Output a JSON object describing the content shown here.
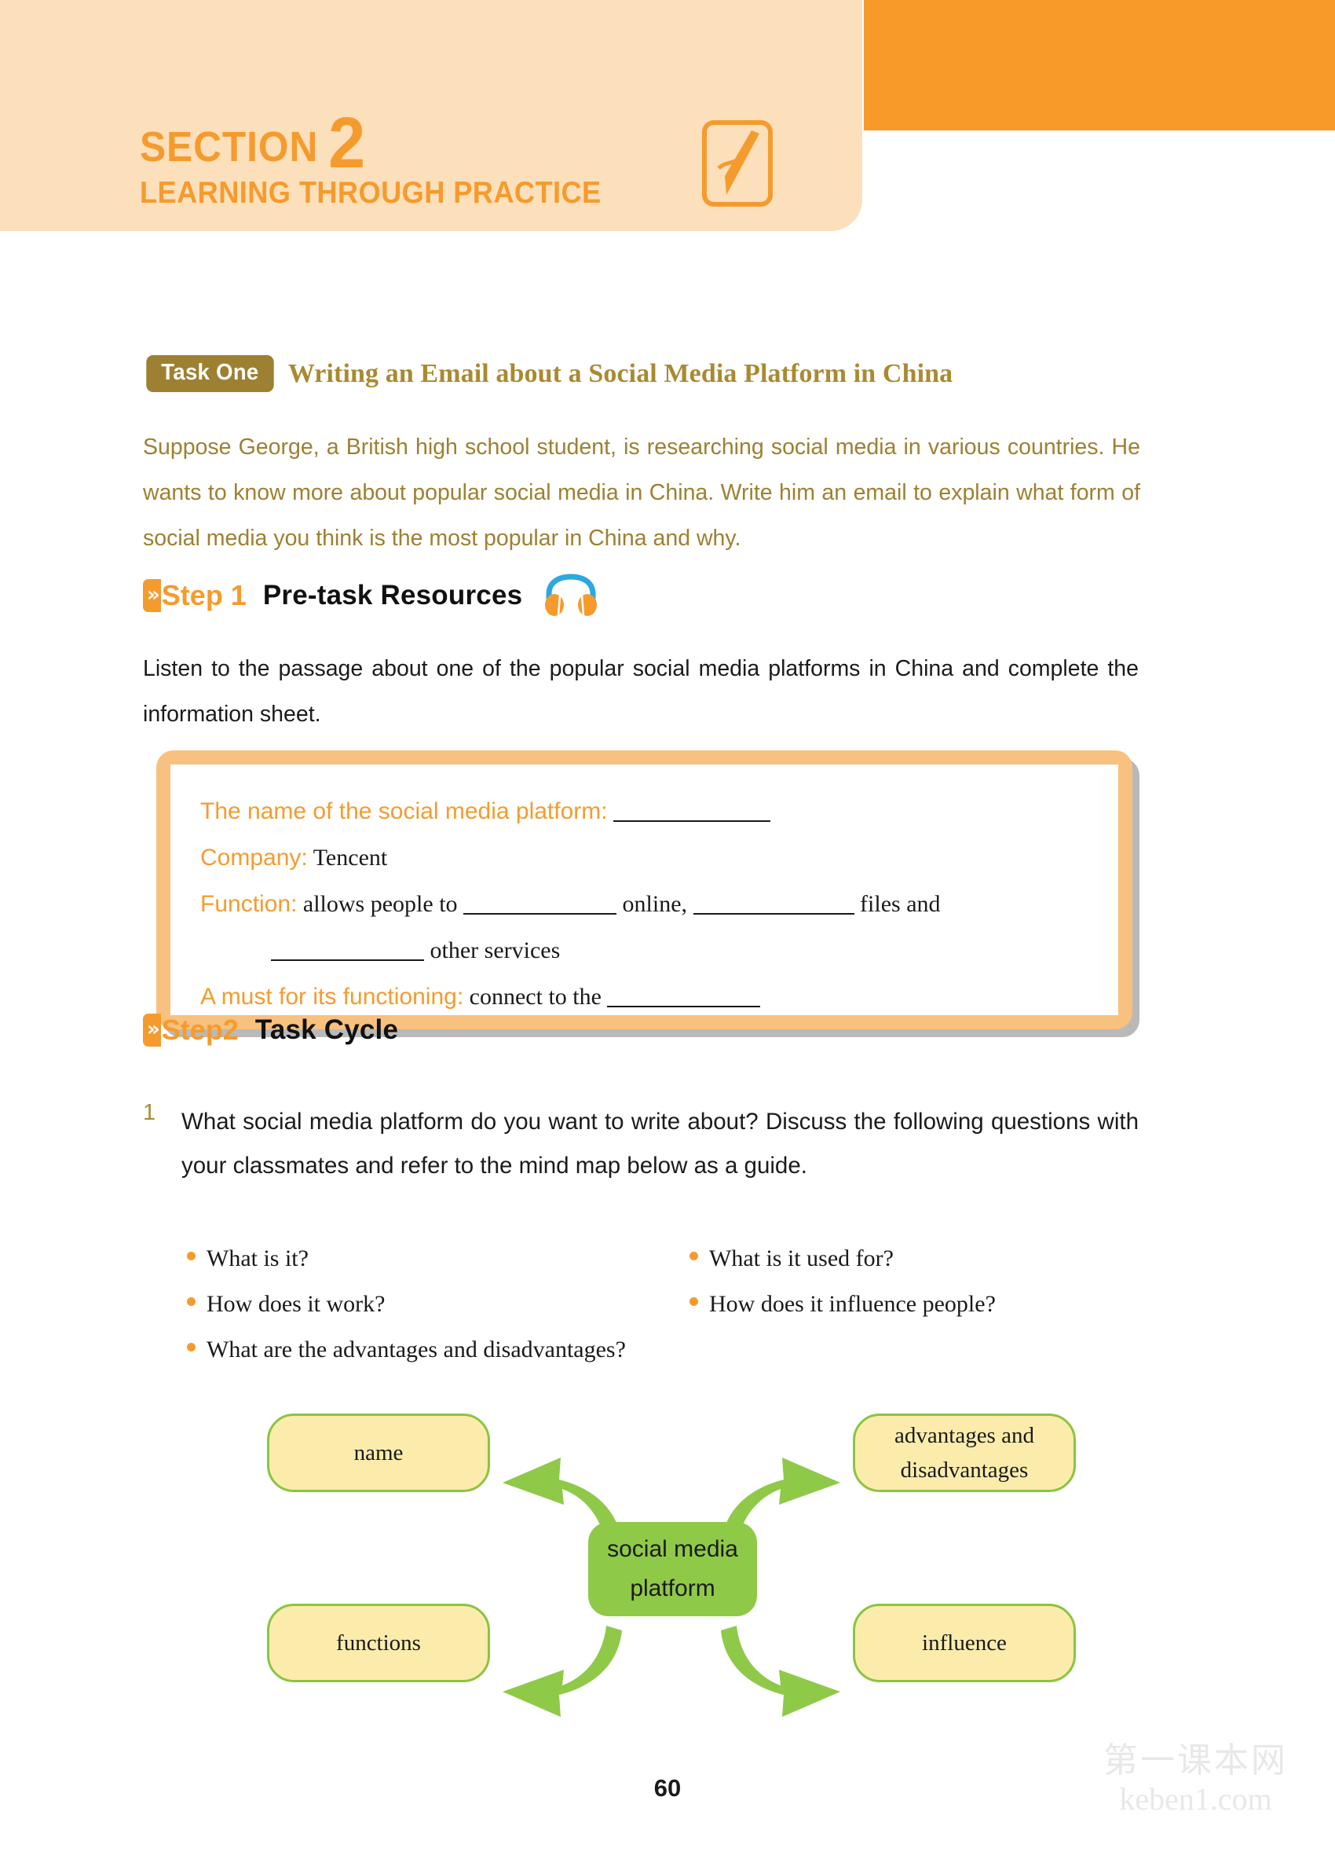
{
  "header": {
    "section_label": "SECTION",
    "section_number": "2",
    "section_subtitle": "LEARNING THROUGH PRACTICE",
    "pen_icon": "pen-writing-icon"
  },
  "task": {
    "badge": "Task One",
    "title": "Writing an Email about a Social Media Platform in China",
    "intro": "Suppose George, a British high school student, is researching social media in various countries. He wants to know more about popular social media in China. Write him an email to explain what form of social media you think is the most popular in China and why."
  },
  "step1": {
    "chevrons": "»",
    "label": "Step 1",
    "subject": "Pre-task Resources",
    "icon": "headphones-icon",
    "instruction": "Listen to the passage about one of the popular social media platforms in China and complete the information sheet."
  },
  "info_sheet": {
    "line1_label": "The name of the social media platform:",
    "line2_label": "Company:",
    "line2_value": "Tencent",
    "line3_label": "Function:",
    "line3_part1": "allows people to",
    "line3_part2": "online,",
    "line3_part3": "files and",
    "line4_part": "other services",
    "line5_label": "A must for its functioning:",
    "line5_part1": "connect to the"
  },
  "step2": {
    "chevrons": "»",
    "label": "Step2",
    "subject": "Task Cycle",
    "item_number": "1",
    "item_text": "What social media platform do you want to write about? Discuss the following questions with your classmates and refer to the mind map below as a guide.",
    "bullets_col1": [
      "What is it?",
      "How does it work?",
      "What are the advantages and disadvantages?"
    ],
    "bullets_col2": [
      "What is it used for?",
      "How does it influence people?"
    ]
  },
  "mindmap": {
    "center": "social media\nplatform",
    "center_line1": "social media",
    "center_line2": "platform",
    "top_left": "name",
    "top_right_line1": "advantages and",
    "top_right_line2": "disadvantages",
    "bottom_left": "functions",
    "bottom_right": "influence"
  },
  "footer": {
    "page_number": "60",
    "watermark_cn": "第一课本网",
    "watermark_en": "keben1.com"
  },
  "colors": {
    "orange": "#f59b2e",
    "banner_bg": "#fce0bb",
    "tab_orange": "#f79a2a",
    "gold": "#9d8031",
    "title_gold": "#a98a32",
    "green": "#8fc948",
    "leaf_yellow": "#fcecac",
    "sheet_border": "#f8c17f"
  }
}
